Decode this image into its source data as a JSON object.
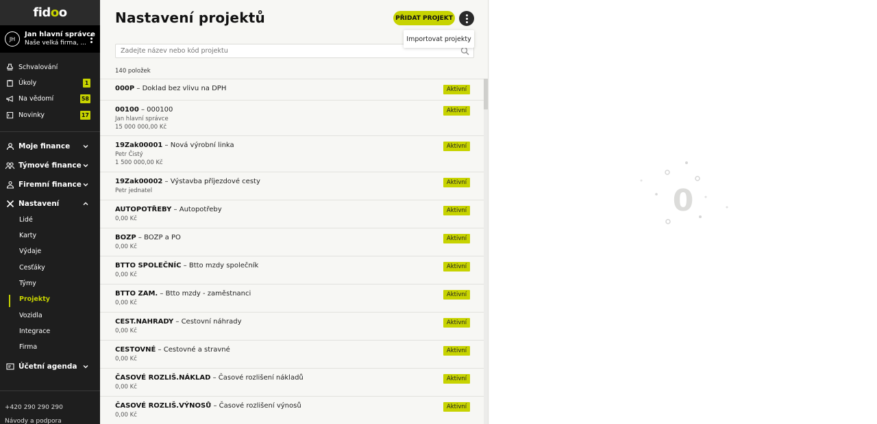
{
  "sidebar": {
    "logo": {
      "pre": "fid",
      "mid": "o",
      "post": "o"
    },
    "user": {
      "initials": "JH",
      "name": "Jan hlavní správce",
      "company": "Naše velká firma, ..."
    },
    "top_items": [
      {
        "label": "Schvalování",
        "icon": "approval-icon",
        "badge": ""
      },
      {
        "label": "Úkoly",
        "icon": "clipboard-icon",
        "badge": "1"
      },
      {
        "label": "Na vědomí",
        "icon": "megaphone-icon",
        "badge": "58"
      },
      {
        "label": "Novinky",
        "icon": "news-icon",
        "badge": "17"
      }
    ],
    "sections": [
      {
        "label": "Moje finance",
        "icon": "user-icon"
      },
      {
        "label": "Týmové finance",
        "icon": "team-icon"
      },
      {
        "label": "Firemní finance",
        "icon": "company-icon"
      },
      {
        "label": "Nastavení",
        "icon": "tools-icon"
      }
    ],
    "settings_items": [
      "Lidé",
      "Karty",
      "Výdaje",
      "Cesťáky",
      "Týmy",
      "Projekty",
      "Vozidla",
      "Integrace",
      "Firma"
    ],
    "active_item": "Projekty",
    "last_section": {
      "label": "Účetní agenda",
      "icon": "ledger-icon"
    },
    "phone": "+420 290 290 290",
    "help": "Návody a podpora"
  },
  "header": {
    "title": "Nastavení projektů",
    "add_button": "PŘIDAT PROJEKT",
    "dropdown_item": "Importovat projekty"
  },
  "search": {
    "placeholder": "Zadejte název nebo kód projektu"
  },
  "count_label": "140 položek",
  "projects": [
    {
      "code": "000P",
      "name": "Doklad bez vlivu na DPH",
      "owner": "",
      "amount": "",
      "status": "Aktivní"
    },
    {
      "code": "00100",
      "name": "000100",
      "owner": "Jan hlavní správce",
      "amount": "15 000 000,00 Kč",
      "status": "Aktivní"
    },
    {
      "code": "19Zak00001",
      "name": "Nová výrobní linka",
      "owner": "Petr Čistý",
      "amount": "1 500 000,00 Kč",
      "status": "Aktivní"
    },
    {
      "code": "19Zak00002",
      "name": "Výstavba příjezdové cesty",
      "owner": "Petr jednatel",
      "amount": "",
      "status": "Aktivní"
    },
    {
      "code": "AUTOPOTŘEBY",
      "name": "Autopotřeby",
      "owner": "",
      "amount": "0,00 Kč",
      "status": "Aktivní"
    },
    {
      "code": "BOZP",
      "name": "BOZP a PO",
      "owner": "",
      "amount": "0,00 Kč",
      "status": "Aktivní"
    },
    {
      "code": "BTTO SPOLEČNÍC",
      "name": "Btto mzdy společník",
      "owner": "",
      "amount": "0,00 Kč",
      "status": "Aktivní"
    },
    {
      "code": "BTTO ZAM.",
      "name": "Btto mzdy - zaměstnanci",
      "owner": "",
      "amount": "0,00 Kč",
      "status": "Aktivní"
    },
    {
      "code": "CEST.NAHRADY",
      "name": "Cestovní náhrady",
      "owner": "",
      "amount": "0,00 Kč",
      "status": "Aktivní"
    },
    {
      "code": "CESTOVNÉ",
      "name": "Cestovné a stravné",
      "owner": "",
      "amount": "0,00 Kč",
      "status": "Aktivní"
    },
    {
      "code": "ČASOVÉ ROZLIŠ.NÁKLAD",
      "name": "Časové rozlišení nákladů",
      "owner": "",
      "amount": "0,00 Kč",
      "status": "Aktivní"
    },
    {
      "code": "ČASOVÉ ROZLIŠ.VÝNOSŮ",
      "name": "Časové rozlišení výnosů",
      "owner": "",
      "amount": "0,00 Kč",
      "status": "Aktivní"
    }
  ],
  "loader": {
    "glyph": "0"
  },
  "colors": {
    "accent": "#c7d300",
    "sidebar_bg": "#1e1e1e"
  }
}
